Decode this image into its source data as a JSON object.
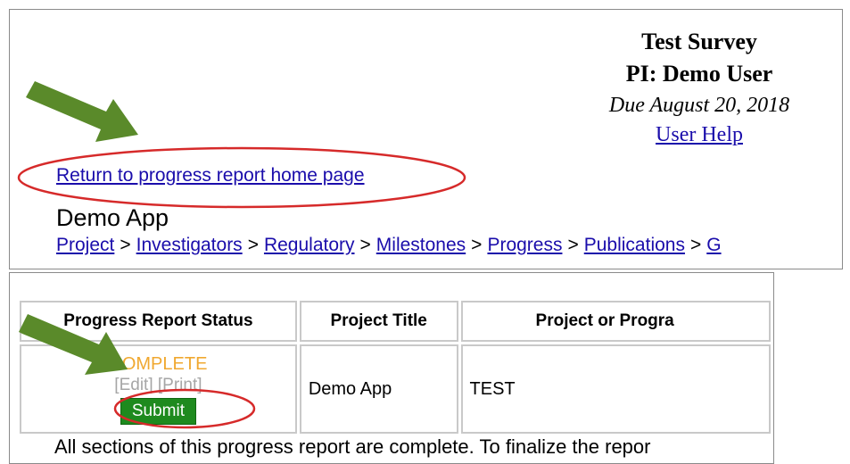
{
  "survey": {
    "title": "Test Survey",
    "pi": "PI: Demo User",
    "due": "Due August 20, 2018",
    "help_link": "User Help"
  },
  "return_link": "Return to progress report home page",
  "app_name": "Demo App",
  "breadcrumb": {
    "items": [
      "Project",
      "Investigators",
      "Regulatory",
      "Milestones",
      "Progress",
      "Publications",
      "G"
    ],
    "separator": ">"
  },
  "table": {
    "headers": [
      "Progress Report Status",
      "Project Title",
      "Project or Progra"
    ],
    "row": {
      "status": "COMPLETE",
      "edit": "[Edit]",
      "print": "[Print]",
      "submit": "Submit",
      "project_title": "Demo App",
      "project_program": "TEST"
    }
  },
  "bottom_message": "All sections of this progress report are complete. To finalize the repor",
  "colors": {
    "link": "#1a0dab",
    "complete": "#f0a830",
    "submit_bg": "#1e8a1e",
    "arrow": "#5a8a2a",
    "annotation_circle": "#d62a2a"
  },
  "icons": [
    "arrow-annotation-icon",
    "circle-annotation-icon"
  ]
}
